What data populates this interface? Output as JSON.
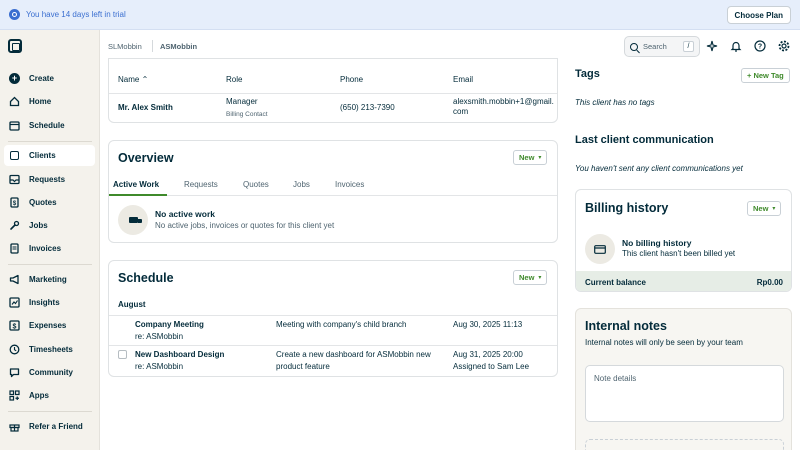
{
  "trial_banner": {
    "text": "You have 14 days left in trial",
    "button": "Choose Plan"
  },
  "sidebar": {
    "items": [
      {
        "label": "Create",
        "icon": "plus-circle-icon"
      },
      {
        "label": "Home",
        "icon": "home-icon"
      },
      {
        "label": "Schedule",
        "icon": "calendar-icon"
      },
      {
        "label": "Clients",
        "icon": "clients-icon"
      },
      {
        "label": "Requests",
        "icon": "inbox-icon"
      },
      {
        "label": "Quotes",
        "icon": "quote-icon"
      },
      {
        "label": "Jobs",
        "icon": "wrench-icon"
      },
      {
        "label": "Invoices",
        "icon": "invoice-icon"
      },
      {
        "label": "Marketing",
        "icon": "megaphone-icon"
      },
      {
        "label": "Insights",
        "icon": "chart-icon"
      },
      {
        "label": "Expenses",
        "icon": "dollar-icon"
      },
      {
        "label": "Timesheets",
        "icon": "clock-icon"
      },
      {
        "label": "Community",
        "icon": "chat-icon"
      },
      {
        "label": "Apps",
        "icon": "apps-icon"
      },
      {
        "label": "Refer a Friend",
        "icon": "gift-icon"
      }
    ]
  },
  "breadcrumb": {
    "parent": "SLMobbin",
    "current": "ASMobbin"
  },
  "search": {
    "placeholder": "Search",
    "shortcut": "/"
  },
  "contacts": {
    "headers": {
      "name": "Name",
      "role": "Role",
      "phone": "Phone",
      "email": "Email"
    },
    "row": {
      "name": "Mr. Alex Smith",
      "role": "Manager",
      "role_sub": "Billing Contact",
      "phone": "(650) 213-7390",
      "email_line1": "alexsmith.mobbin+1@gmail.",
      "email_line2": "com"
    }
  },
  "overview": {
    "title": "Overview",
    "new_label": "New",
    "tabs": [
      "Active Work",
      "Requests",
      "Quotes",
      "Jobs",
      "Invoices"
    ],
    "empty_title": "No active work",
    "empty_text": "No active jobs, invoices or quotes for this client yet"
  },
  "schedule": {
    "title": "Schedule",
    "new_label": "New",
    "month": "August",
    "items": [
      {
        "title": "Company Meeting",
        "sub": "re: ASMobbin",
        "desc": "Meeting with company's child branch",
        "desc2": "",
        "date": "Aug 30, 2025 11:13",
        "date2": ""
      },
      {
        "title": "New Dashboard Design",
        "sub": "re: ASMobbin",
        "desc": "Create a new dashboard for ASMobbin new",
        "desc2": "product feature",
        "date": "Aug 31, 2025 20:00",
        "date2": "Assigned to Sam Lee"
      }
    ]
  },
  "tags": {
    "title": "Tags",
    "button": "+ New Tag",
    "empty": "This client has no tags"
  },
  "communication": {
    "title": "Last client communication",
    "empty": "You haven't sent any client communications yet"
  },
  "billing": {
    "title": "Billing history",
    "new_label": "New",
    "empty_title": "No billing history",
    "empty_text": "This client hasn't been billed yet",
    "balance_label": "Current balance",
    "balance_value": "Rp0.00"
  },
  "notes": {
    "title": "Internal notes",
    "subtitle": "Internal notes will only be seen by your team",
    "placeholder": "Note details"
  }
}
